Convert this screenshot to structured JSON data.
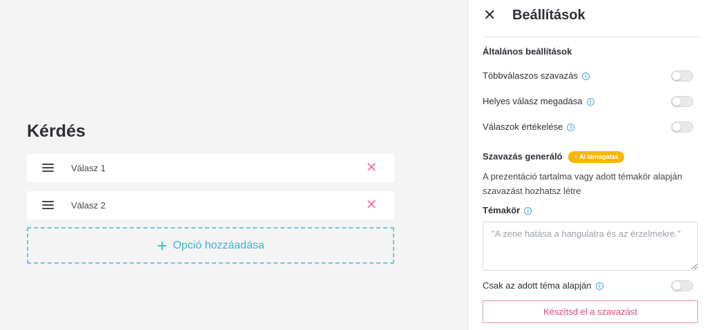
{
  "editor": {
    "question_title": "Kérdés",
    "options": [
      {
        "label": "Válasz 1"
      },
      {
        "label": "Válasz 2"
      }
    ],
    "add_option_label": "Opció hozzáadása",
    "remove_glyph": "✕",
    "add_glyph": "+"
  },
  "panel": {
    "title": "Beállítások",
    "close_glyph": "✕",
    "general_section_title": "Általános beállítások",
    "settings": [
      {
        "label": "Többválaszos szavazás",
        "enabled": false
      },
      {
        "label": "Helyes válasz megadása",
        "enabled": false
      },
      {
        "label": "Válaszok értékelése",
        "enabled": false
      }
    ],
    "generator": {
      "title": "Szavazás generáló",
      "ai_badge": "AI támogatás",
      "description": "A prezentáció tartalma vagy adott témakör alapján szavazást hozhatsz létre",
      "topic_label": "Témakör",
      "topic_placeholder": "\"A zene hatása a hangulatra és az érzelmekre.\"",
      "topic_value": "",
      "only_topic_label": "Csak az adott téma alapján",
      "only_topic_enabled": false,
      "generate_button": "Készítsd el a szavazást"
    }
  },
  "colors": {
    "accent_teal": "#3fb3cc",
    "remove_pink": "#f07a9a",
    "button_pink": "#e2457a",
    "badge_yellow": "#f6b800",
    "info_blue": "#3fa7d8"
  },
  "icons": {
    "drag": "drag-handle-icon",
    "remove": "close-icon",
    "add": "plus-icon",
    "info": "info-icon",
    "ai": "sparkle-icon"
  }
}
